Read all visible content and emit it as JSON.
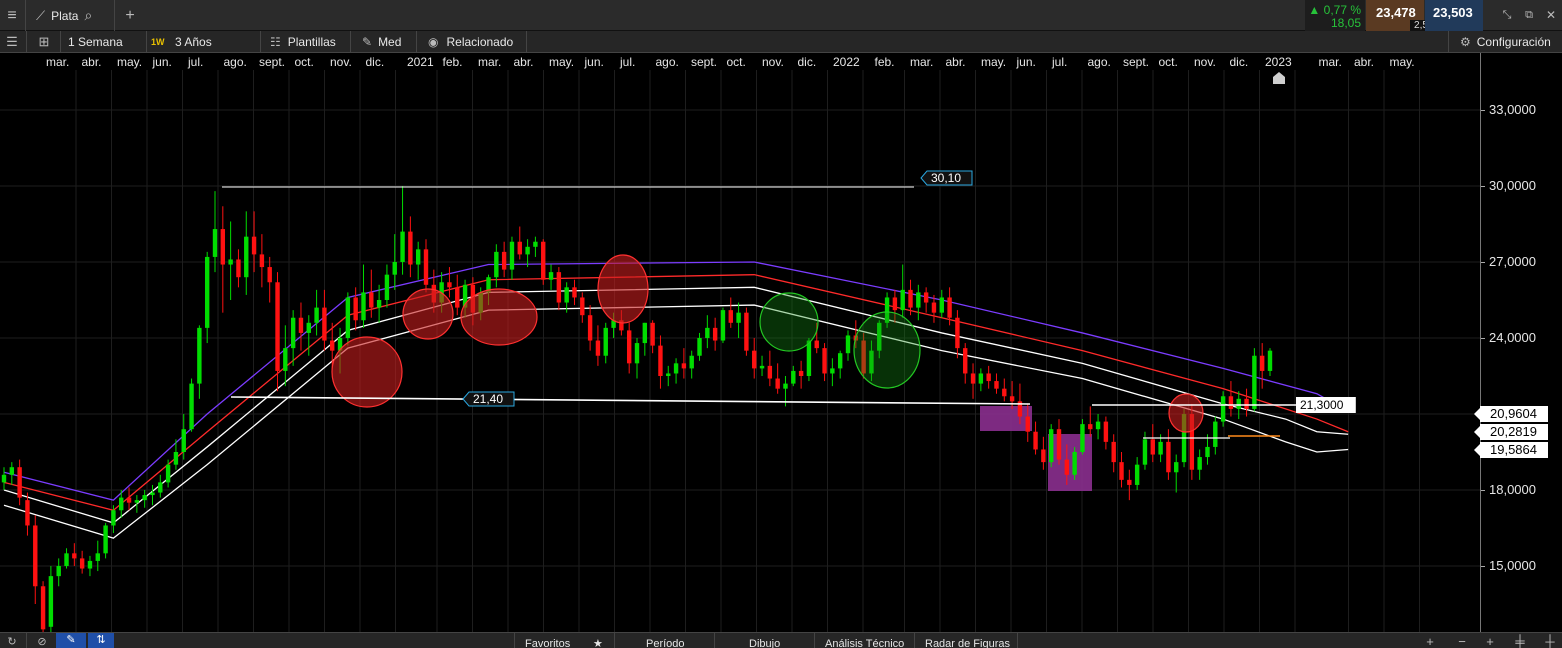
{
  "header": {
    "symbol": "Plata",
    "change_pct": "0,77 %",
    "change_abs": "18,05",
    "bid": "23,478",
    "spread": "2,5",
    "ask": "23,503"
  },
  "toolbar": {
    "interval": "1 Semana",
    "interval_badge": "1W",
    "range": "3 Años",
    "templates": "Plantillas",
    "indicator": "Med",
    "related": "Relacionado",
    "config": "Configuración"
  },
  "bottom": {
    "tabs": [
      "Favoritos",
      "Período",
      "Dibujo",
      "Análisis Técnico",
      "Radar de Figuras"
    ]
  },
  "colors": {
    "up": "#00dd00",
    "down": "#ff1111",
    "accent_green": "#27c23a",
    "purple_band": "#8b2f8f"
  },
  "chart_data": {
    "type": "candlestick",
    "x_labels": [
      "mar.",
      "abr.",
      "may.",
      "jun.",
      "jul.",
      "ago.",
      "sept.",
      "oct.",
      "nov.",
      "dic.",
      "2021",
      "feb.",
      "mar.",
      "abr.",
      "may.",
      "jun.",
      "jul.",
      "ago.",
      "sept.",
      "oct.",
      "nov.",
      "dic.",
      "2022",
      "feb.",
      "mar.",
      "abr.",
      "may.",
      "jun.",
      "jul.",
      "ago.",
      "sept.",
      "oct.",
      "nov.",
      "dic.",
      "2023",
      "mar.",
      "abr.",
      "may."
    ],
    "y_ticks": [
      "33,0000",
      "30,0000",
      "27,0000",
      "24,0000",
      "18,0000",
      "15,0000"
    ],
    "ylim": [
      12.2,
      34.3
    ],
    "price_labels": [
      "20,9604",
      "20,2819",
      "19,5864"
    ],
    "line_labels": [
      "30,10",
      "21,40",
      "21,3000"
    ],
    "candles": [
      [
        18.3,
        18.9,
        18.0,
        18.6
      ],
      [
        18.6,
        19.1,
        18.2,
        18.9
      ],
      [
        18.9,
        19.2,
        17.4,
        17.7
      ],
      [
        17.6,
        17.9,
        16.2,
        16.6
      ],
      [
        16.6,
        17.0,
        13.5,
        14.2
      ],
      [
        14.2,
        14.4,
        11.7,
        12.5
      ],
      [
        12.6,
        15.0,
        12.2,
        14.6
      ],
      [
        14.6,
        15.3,
        14.2,
        15.0
      ],
      [
        15.0,
        15.7,
        14.9,
        15.5
      ],
      [
        15.5,
        15.9,
        15.0,
        15.3
      ],
      [
        15.3,
        15.6,
        14.7,
        14.9
      ],
      [
        14.9,
        15.4,
        14.6,
        15.2
      ],
      [
        15.2,
        16.0,
        14.8,
        15.5
      ],
      [
        15.5,
        16.7,
        15.3,
        16.6
      ],
      [
        16.6,
        17.4,
        16.3,
        17.2
      ],
      [
        17.2,
        18.0,
        16.9,
        17.7
      ],
      [
        17.7,
        18.1,
        17.2,
        17.5
      ],
      [
        17.5,
        17.8,
        17.1,
        17.6
      ],
      [
        17.6,
        18.0,
        17.3,
        17.8
      ],
      [
        17.8,
        18.2,
        17.4,
        17.9
      ],
      [
        17.9,
        18.6,
        17.7,
        18.3
      ],
      [
        18.3,
        19.2,
        18.1,
        19.0
      ],
      [
        19.0,
        20.0,
        18.8,
        19.5
      ],
      [
        19.5,
        21.0,
        19.2,
        20.4
      ],
      [
        20.4,
        22.4,
        20.3,
        22.2
      ],
      [
        22.2,
        24.5,
        21.6,
        24.4
      ],
      [
        24.4,
        27.4,
        23.8,
        27.2
      ],
      [
        27.2,
        29.8,
        26.6,
        28.3
      ],
      [
        28.3,
        29.2,
        25.0,
        26.9
      ],
      [
        26.9,
        28.6,
        25.5,
        27.1
      ],
      [
        27.1,
        27.5,
        26.0,
        26.4
      ],
      [
        26.4,
        29.0,
        25.7,
        28.0
      ],
      [
        28.0,
        29.0,
        26.6,
        27.3
      ],
      [
        27.3,
        28.1,
        26.0,
        26.8
      ],
      [
        26.8,
        27.2,
        25.4,
        26.2
      ],
      [
        26.2,
        26.6,
        21.9,
        22.7
      ],
      [
        22.7,
        24.5,
        22.1,
        23.6
      ],
      [
        23.6,
        25.1,
        22.9,
        24.8
      ],
      [
        24.8,
        25.4,
        23.5,
        24.2
      ],
      [
        24.2,
        24.9,
        23.3,
        24.6
      ],
      [
        24.6,
        25.9,
        24.1,
        25.2
      ],
      [
        25.2,
        25.9,
        23.5,
        23.9
      ],
      [
        23.9,
        24.6,
        22.8,
        23.5
      ],
      [
        23.5,
        24.4,
        22.6,
        24.0
      ],
      [
        24.0,
        25.8,
        23.7,
        25.6
      ],
      [
        25.6,
        26.0,
        24.3,
        24.7
      ],
      [
        24.7,
        26.9,
        24.4,
        25.8
      ],
      [
        25.8,
        26.7,
        24.8,
        25.2
      ],
      [
        25.2,
        26.1,
        24.6,
        25.5
      ],
      [
        25.5,
        26.9,
        25.2,
        26.5
      ],
      [
        26.5,
        28.1,
        25.9,
        27.0
      ],
      [
        27.0,
        30.0,
        26.5,
        28.2
      ],
      [
        28.2,
        28.8,
        26.4,
        26.9
      ],
      [
        26.9,
        27.8,
        26.3,
        27.5
      ],
      [
        27.5,
        27.9,
        25.8,
        26.1
      ],
      [
        26.1,
        26.7,
        25.0,
        25.4
      ],
      [
        25.4,
        26.6,
        25.0,
        26.2
      ],
      [
        26.2,
        26.8,
        25.6,
        26.0
      ],
      [
        26.0,
        26.5,
        24.9,
        25.2
      ],
      [
        25.2,
        26.3,
        24.8,
        26.1
      ],
      [
        26.1,
        26.4,
        24.5,
        25.0
      ],
      [
        25.0,
        26.0,
        24.7,
        25.8
      ],
      [
        25.8,
        26.5,
        25.3,
        26.4
      ],
      [
        26.4,
        27.7,
        26.0,
        27.4
      ],
      [
        27.4,
        27.8,
        26.4,
        26.7
      ],
      [
        26.7,
        28.0,
        26.3,
        27.8
      ],
      [
        27.8,
        28.4,
        27.1,
        27.3
      ],
      [
        27.3,
        27.9,
        26.8,
        27.6
      ],
      [
        27.6,
        28.0,
        27.2,
        27.8
      ],
      [
        27.8,
        27.9,
        26.1,
        26.3
      ],
      [
        26.3,
        26.9,
        25.9,
        26.6
      ],
      [
        26.6,
        26.8,
        25.1,
        25.4
      ],
      [
        25.4,
        26.2,
        25.0,
        26.0
      ],
      [
        26.0,
        26.3,
        25.3,
        25.6
      ],
      [
        25.6,
        25.8,
        24.6,
        24.9
      ],
      [
        24.9,
        25.3,
        23.5,
        23.9
      ],
      [
        23.9,
        24.5,
        22.9,
        23.3
      ],
      [
        23.3,
        24.6,
        23.0,
        24.4
      ],
      [
        24.4,
        25.0,
        24.0,
        24.7
      ],
      [
        24.7,
        25.1,
        24.1,
        24.3
      ],
      [
        24.3,
        24.6,
        22.6,
        23.0
      ],
      [
        23.0,
        24.0,
        22.4,
        23.8
      ],
      [
        23.8,
        24.6,
        23.3,
        24.6
      ],
      [
        24.6,
        24.7,
        23.4,
        23.7
      ],
      [
        23.7,
        24.1,
        22.0,
        22.5
      ],
      [
        22.5,
        22.9,
        22.1,
        22.6
      ],
      [
        22.6,
        23.2,
        22.2,
        23.0
      ],
      [
        23.0,
        23.6,
        22.4,
        22.8
      ],
      [
        22.8,
        23.5,
        22.4,
        23.3
      ],
      [
        23.3,
        24.2,
        23.1,
        24.0
      ],
      [
        24.0,
        24.9,
        23.6,
        24.4
      ],
      [
        24.4,
        24.8,
        23.5,
        23.9
      ],
      [
        23.9,
        25.2,
        23.8,
        25.1
      ],
      [
        25.1,
        25.6,
        24.4,
        24.6
      ],
      [
        24.6,
        25.4,
        24.0,
        25.0
      ],
      [
        25.0,
        25.2,
        23.3,
        23.5
      ],
      [
        23.5,
        24.0,
        22.4,
        22.8
      ],
      [
        22.8,
        23.3,
        22.5,
        22.9
      ],
      [
        22.9,
        23.5,
        22.1,
        22.4
      ],
      [
        22.4,
        23.0,
        21.8,
        22.0
      ],
      [
        22.0,
        22.5,
        21.3,
        22.2
      ],
      [
        22.2,
        22.9,
        22.1,
        22.7
      ],
      [
        22.7,
        23.1,
        22.0,
        22.5
      ],
      [
        22.5,
        24.0,
        22.3,
        23.9
      ],
      [
        23.9,
        24.6,
        23.4,
        23.6
      ],
      [
        23.6,
        23.8,
        22.3,
        22.6
      ],
      [
        22.6,
        23.2,
        22.1,
        22.8
      ],
      [
        22.8,
        23.5,
        22.4,
        23.4
      ],
      [
        23.4,
        24.3,
        23.1,
        24.1
      ],
      [
        24.1,
        24.7,
        23.6,
        23.9
      ],
      [
        23.9,
        24.2,
        22.4,
        22.6
      ],
      [
        22.6,
        23.9,
        22.3,
        23.5
      ],
      [
        23.5,
        24.7,
        23.2,
        24.6
      ],
      [
        24.6,
        25.8,
        24.4,
        25.6
      ],
      [
        25.6,
        25.9,
        24.6,
        25.1
      ],
      [
        25.1,
        26.9,
        24.8,
        25.9
      ],
      [
        25.9,
        26.3,
        24.9,
        25.2
      ],
      [
        25.2,
        26.1,
        24.7,
        25.8
      ],
      [
        25.8,
        26.0,
        25.0,
        25.4
      ],
      [
        25.4,
        25.7,
        24.6,
        25.0
      ],
      [
        25.0,
        25.9,
        24.8,
        25.6
      ],
      [
        25.6,
        26.0,
        24.5,
        24.8
      ],
      [
        24.8,
        25.1,
        23.2,
        23.6
      ],
      [
        23.6,
        23.8,
        22.2,
        22.6
      ],
      [
        22.6,
        23.0,
        21.6,
        22.2
      ],
      [
        22.2,
        22.8,
        21.9,
        22.6
      ],
      [
        22.6,
        22.9,
        22.0,
        22.3
      ],
      [
        22.3,
        22.6,
        21.8,
        22.0
      ],
      [
        22.0,
        22.4,
        21.5,
        21.7
      ],
      [
        21.7,
        22.3,
        21.2,
        21.5
      ],
      [
        21.5,
        22.2,
        20.6,
        20.9
      ],
      [
        20.9,
        21.4,
        19.9,
        20.3
      ],
      [
        20.3,
        20.7,
        19.4,
        19.6
      ],
      [
        19.6,
        20.1,
        18.8,
        19.1
      ],
      [
        19.1,
        20.6,
        18.9,
        20.4
      ],
      [
        20.4,
        20.8,
        19.0,
        19.2
      ],
      [
        19.2,
        19.8,
        18.2,
        18.6
      ],
      [
        18.6,
        19.7,
        18.4,
        19.5
      ],
      [
        19.5,
        20.8,
        19.4,
        20.6
      ],
      [
        20.6,
        21.3,
        20.1,
        20.4
      ],
      [
        20.4,
        21.0,
        20.0,
        20.7
      ],
      [
        20.7,
        20.9,
        19.6,
        19.9
      ],
      [
        19.9,
        20.2,
        18.7,
        19.1
      ],
      [
        19.1,
        19.5,
        18.1,
        18.4
      ],
      [
        18.4,
        18.8,
        17.6,
        18.2
      ],
      [
        18.2,
        19.3,
        18.0,
        19.0
      ],
      [
        19.0,
        20.3,
        18.8,
        20.0
      ],
      [
        20.0,
        20.6,
        19.1,
        19.4
      ],
      [
        19.4,
        20.2,
        19.1,
        19.9
      ],
      [
        19.9,
        20.4,
        18.4,
        18.7
      ],
      [
        18.7,
        19.4,
        17.9,
        19.1
      ],
      [
        19.1,
        21.2,
        18.9,
        21.0
      ],
      [
        21.0,
        21.4,
        18.4,
        18.8
      ],
      [
        18.8,
        19.6,
        18.4,
        19.3
      ],
      [
        19.3,
        20.2,
        19.0,
        19.7
      ],
      [
        19.7,
        20.9,
        19.4,
        20.7
      ],
      [
        20.7,
        21.9,
        20.5,
        21.7
      ],
      [
        21.7,
        22.3,
        20.9,
        21.2
      ],
      [
        21.2,
        21.9,
        20.8,
        21.6
      ],
      [
        21.6,
        22.0,
        20.9,
        21.2
      ],
      [
        21.2,
        23.6,
        21.1,
        23.3
      ],
      [
        23.3,
        23.8,
        22.0,
        22.7
      ],
      [
        22.7,
        23.6,
        22.5,
        23.5
      ]
    ],
    "ma_lines": [
      {
        "color": "#7b3cff",
        "y0": 18.7,
        "legs": [
          [
            0,
            18.7
          ],
          [
            14,
            17.6
          ],
          [
            26,
            21.0
          ],
          [
            44,
            25.6
          ],
          [
            62,
            26.9
          ],
          [
            96,
            27.0
          ],
          [
            120,
            25.5
          ],
          [
            138,
            24.2
          ],
          [
            156,
            22.8
          ],
          [
            168,
            21.8
          ],
          [
            172,
            21.1
          ]
        ]
      },
      {
        "color": "#ff2a2a",
        "legs": [
          [
            0,
            18.3
          ],
          [
            14,
            17.2
          ],
          [
            26,
            20.3
          ],
          [
            44,
            24.9
          ],
          [
            62,
            26.3
          ],
          [
            96,
            26.5
          ],
          [
            120,
            24.8
          ],
          [
            138,
            23.5
          ],
          [
            156,
            22.0
          ],
          [
            168,
            20.8
          ],
          [
            172,
            20.3
          ]
        ]
      },
      {
        "color": "#ffffff",
        "legs": [
          [
            0,
            18.0
          ],
          [
            14,
            16.7
          ],
          [
            26,
            19.7
          ],
          [
            44,
            24.3
          ],
          [
            62,
            25.8
          ],
          [
            96,
            26.0
          ],
          [
            120,
            24.2
          ],
          [
            138,
            23.0
          ],
          [
            156,
            21.4
          ],
          [
            164,
            20.8
          ],
          [
            168,
            20.3
          ],
          [
            172,
            20.2
          ]
        ]
      },
      {
        "color": "#ffffff",
        "legs": [
          [
            0,
            17.4
          ],
          [
            14,
            16.1
          ],
          [
            26,
            19.0
          ],
          [
            44,
            23.6
          ],
          [
            62,
            25.1
          ],
          [
            96,
            25.3
          ],
          [
            120,
            23.5
          ],
          [
            138,
            22.4
          ],
          [
            156,
            20.8
          ],
          [
            164,
            19.9
          ],
          [
            168,
            19.5
          ],
          [
            172,
            19.6
          ]
        ]
      }
    ]
  }
}
